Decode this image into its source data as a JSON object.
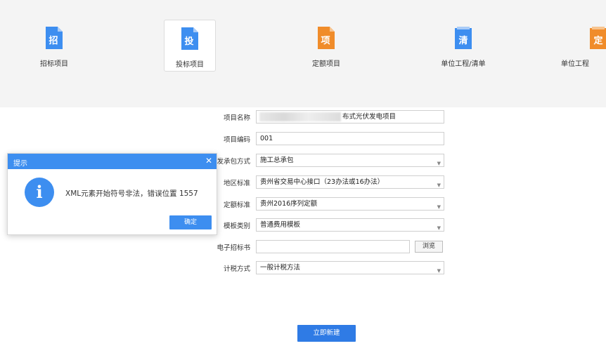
{
  "toolbar": {
    "tiles": [
      {
        "label": "招标项目",
        "glyph": "招",
        "color": "#3d8ef0"
      },
      {
        "label": "投标项目",
        "glyph": "投",
        "color": "#3d8ef0"
      },
      {
        "label": "定额项目",
        "glyph": "项",
        "color": "#f08c2a"
      },
      {
        "label": "单位工程/清单",
        "glyph": "清",
        "color": "#3d8ef0"
      },
      {
        "label": "单位工程",
        "glyph": "定",
        "color": "#f08c2a"
      }
    ]
  },
  "form": {
    "project_name": {
      "label": "项目名称",
      "value_tail": "布式光伏发电项目"
    },
    "project_code": {
      "label": "项目编码",
      "value": "001"
    },
    "contract_mode": {
      "label": "发承包方式",
      "value": "施工总承包"
    },
    "region_std": {
      "label": "地区标准",
      "value": "贵州省交易中心接口（23办法或16办法）"
    },
    "quota_std": {
      "label": "定额标准",
      "value": "贵州2016序列定额"
    },
    "template_type": {
      "label": "模板类别",
      "value": "普通费用模板"
    },
    "tender_file": {
      "label": "电子招标书",
      "value": "",
      "browse_label": "浏览"
    },
    "tax_method": {
      "label": "计税方式",
      "value": "一般计税方法"
    },
    "submit_label": "立即新建"
  },
  "dialog": {
    "title": "提示",
    "close_glyph": "✕",
    "icon_glyph": "i",
    "message": "XML元素开始符号非法，错误位置 1557",
    "ok_label": "确定"
  },
  "colors": {
    "accent": "#3d8ef0",
    "primary_button": "#2f7be5",
    "orange": "#f08c2a"
  }
}
